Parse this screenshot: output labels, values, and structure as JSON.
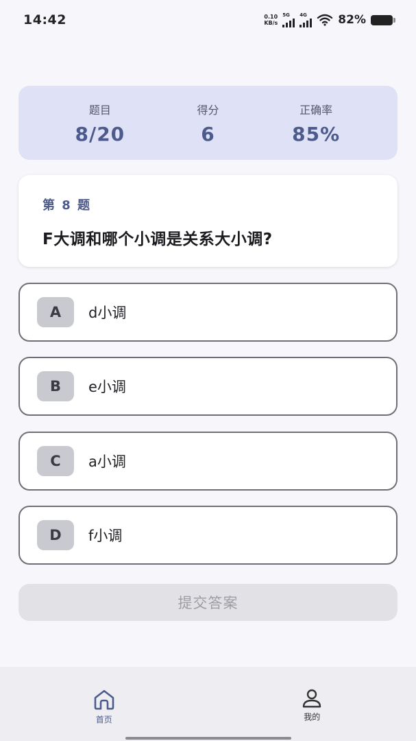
{
  "status_bar": {
    "time": "14:42",
    "net_speed_value": "0.10",
    "net_speed_unit": "KB/s",
    "sig1_tag": "5G",
    "sig2_tag": "4G",
    "battery": "82%"
  },
  "stats": {
    "question_label": "题目",
    "question_value": "8/20",
    "score_label": "得分",
    "score_value": "6",
    "accuracy_label": "正确率",
    "accuracy_value": "85%"
  },
  "question": {
    "number": "第 8 题",
    "text": "F大调和哪个小调是关系大小调?"
  },
  "options": [
    {
      "letter": "A",
      "text": "d小调"
    },
    {
      "letter": "B",
      "text": "e小调"
    },
    {
      "letter": "C",
      "text": "a小调"
    },
    {
      "letter": "D",
      "text": "f小调"
    }
  ],
  "submit_label": "提交答案",
  "nav": {
    "home_label": "首页",
    "home_icon": "home-icon",
    "mine_label": "我的",
    "mine_icon": "user-icon"
  },
  "colors": {
    "accent": "#4d5a8c",
    "stats_bg": "#dfe2f7",
    "option_border": "#6e6e76",
    "submit_disabled": "#e2e2e6"
  }
}
